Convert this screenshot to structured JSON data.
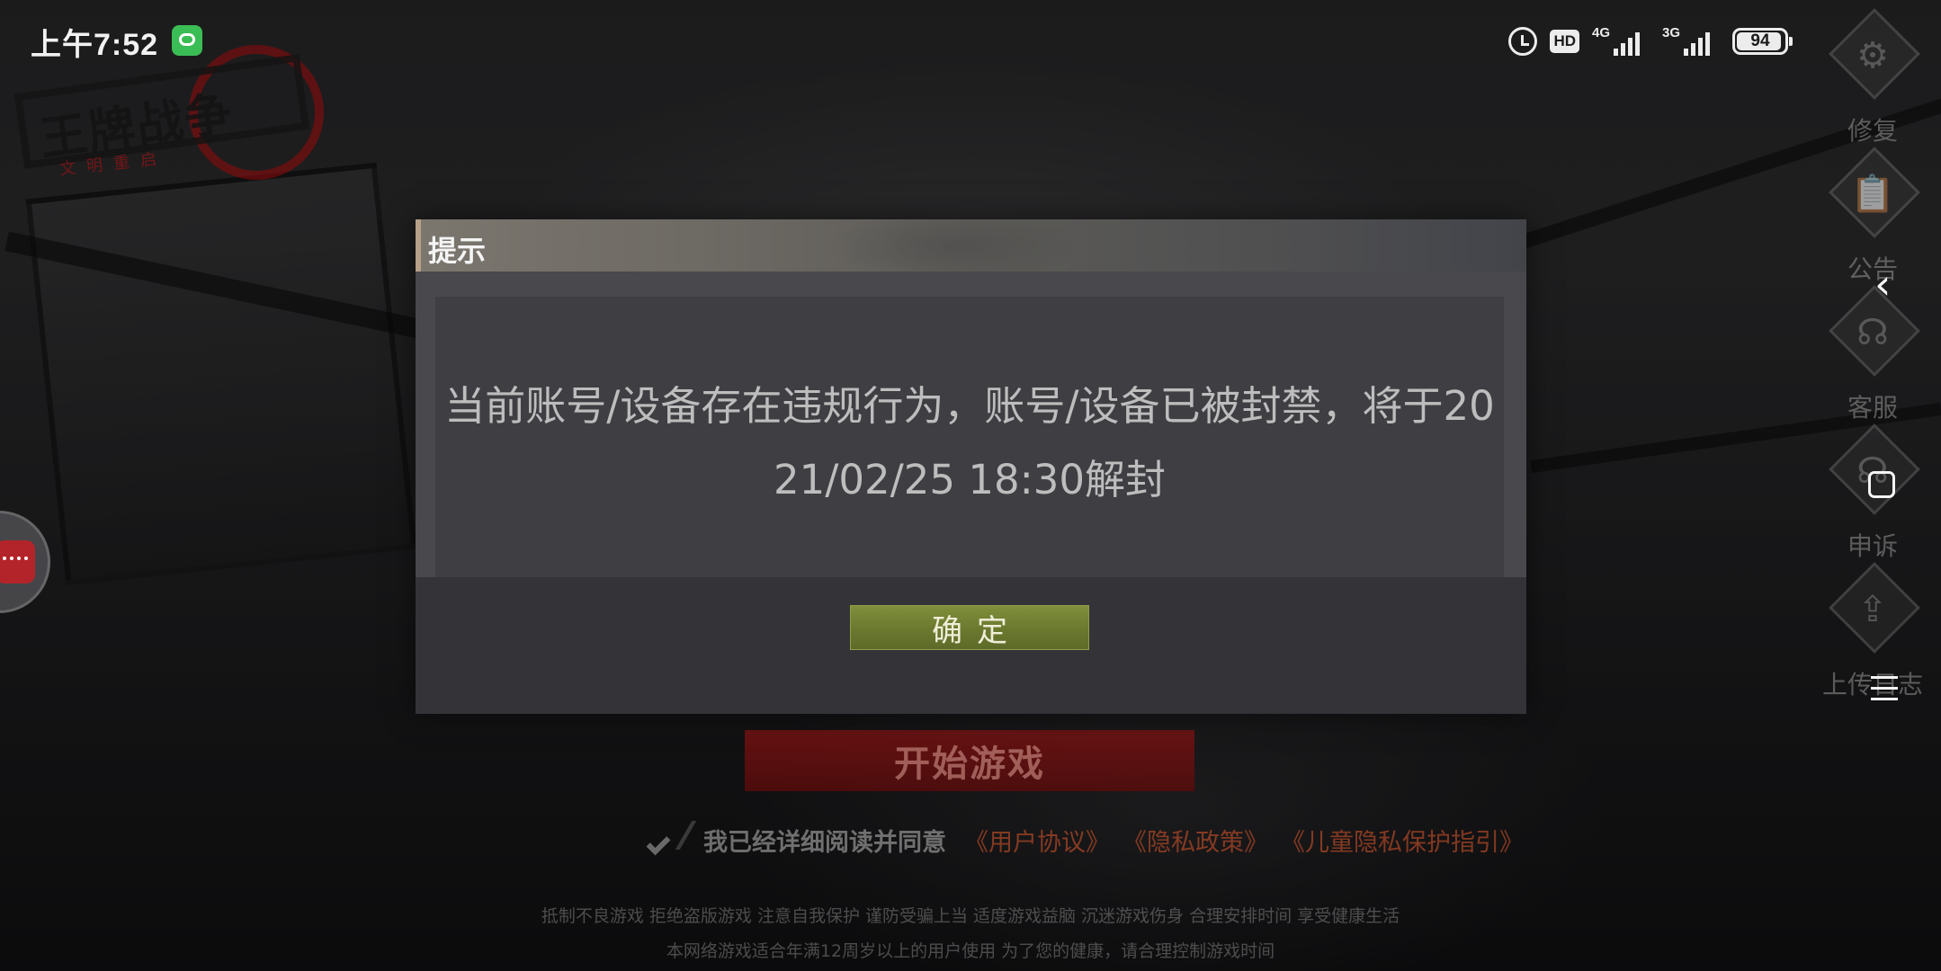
{
  "status_bar": {
    "time": "上午7:52",
    "hd": "HD",
    "signal1_net": "4G",
    "signal2_net": "3G",
    "battery": "94",
    "battery_level": 0.94
  },
  "logo": {
    "title": "王牌战争",
    "subtitle": "文明重启"
  },
  "sidebar": {
    "items": [
      {
        "label": "修复",
        "icon": "gear-icon"
      },
      {
        "label": "公告",
        "icon": "notice-icon"
      },
      {
        "label": "客服",
        "icon": "headset-icon"
      },
      {
        "label": "申诉",
        "icon": "appeal-icon"
      },
      {
        "label": "上传日志",
        "icon": "upload-icon"
      }
    ]
  },
  "dialog": {
    "title": "提示",
    "message": "当前账号/设备存在违规行为，账号/设备已被封禁，将于2021/02/25 18:30解封",
    "confirm_label": "确定"
  },
  "start": {
    "button_label": "开始游戏",
    "agree_text": "我已经详细阅读并同意",
    "links": [
      "《用户协议》",
      "《隐私政策》",
      "《儿童隐私保护指引》"
    ]
  },
  "footer": {
    "line1": "抵制不良游戏 拒绝盗版游戏 注意自我保护 谨防受骗上当 适度游戏益脑 沉迷游戏伤身 合理安排时间 享受健康生活",
    "line2": "本网络游戏适合年满12周岁以上的用户使用    为了您的健康，请合理控制游戏时间"
  },
  "colors": {
    "confirm_button": "#6c7b30",
    "start_button": "#82121a",
    "link": "#c85028"
  }
}
